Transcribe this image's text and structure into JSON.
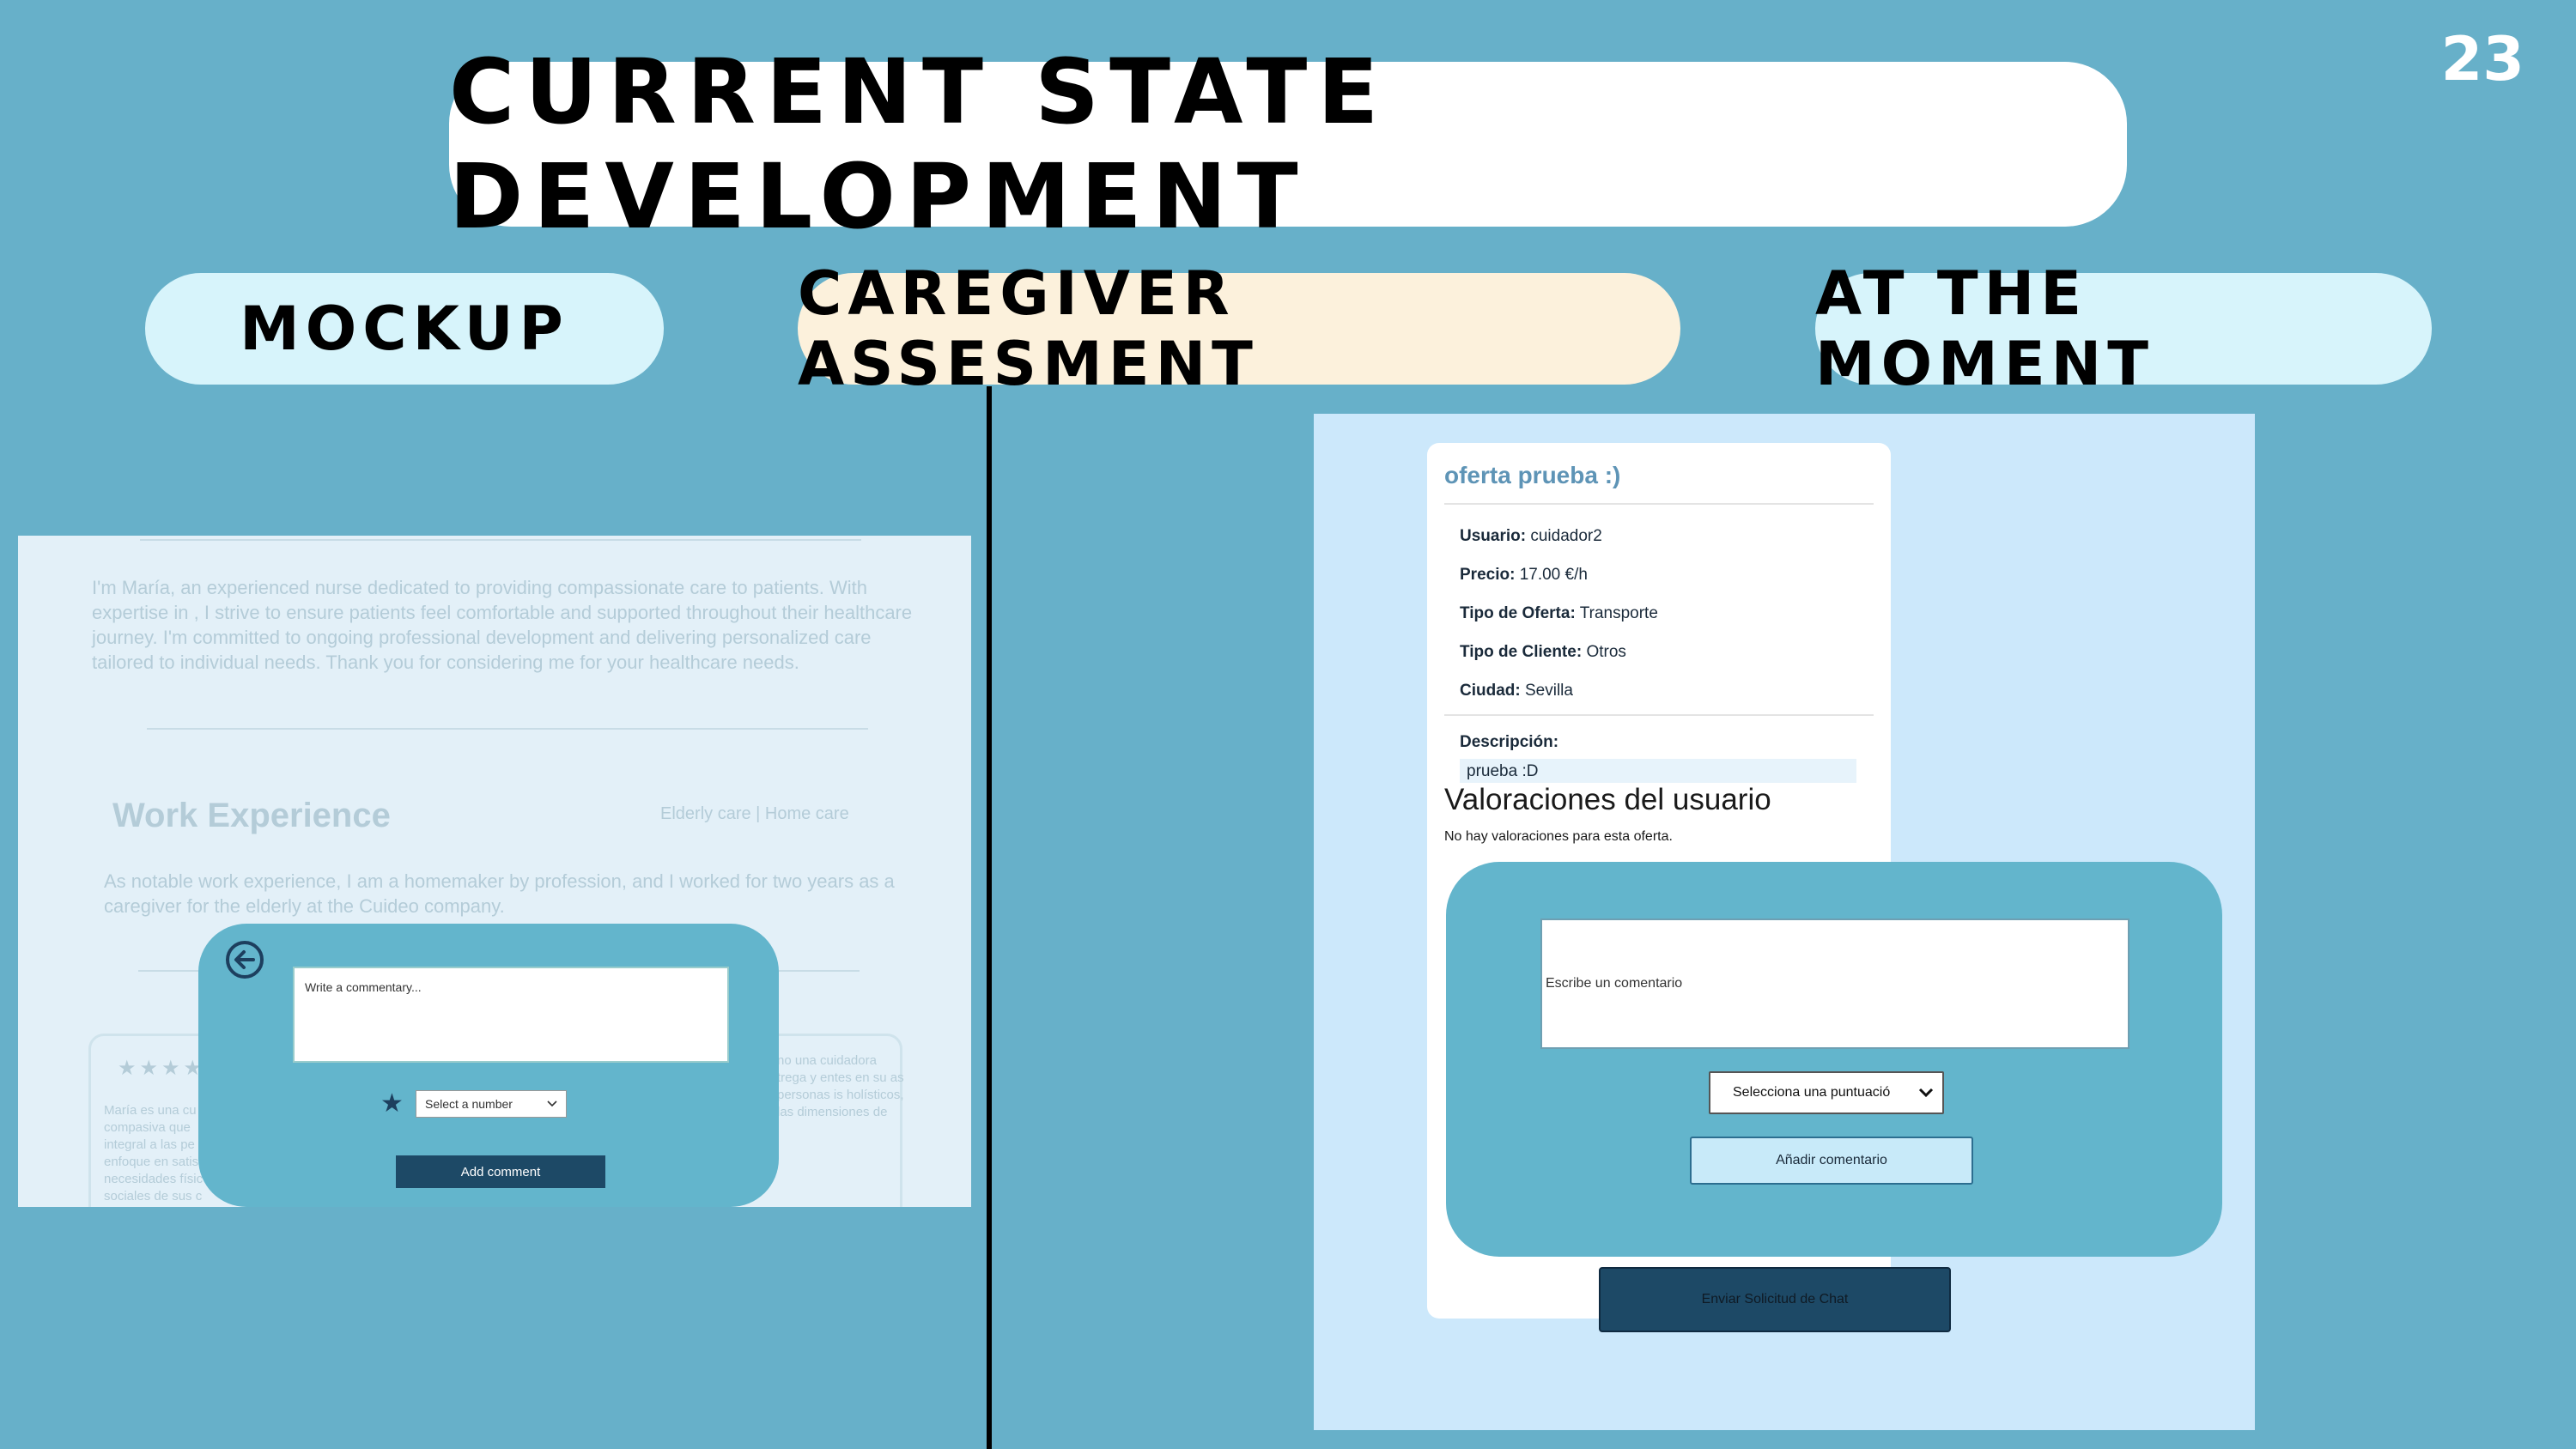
{
  "slide": {
    "title": "CURRENT STATE DEVELOPMENT",
    "page_number": "23",
    "labels": {
      "mockup": "MOCKUP",
      "center": "CAREGIVER ASSESMENT",
      "now": "AT THE MOMENT"
    }
  },
  "mockup": {
    "intro": "I'm María, an experienced nurse dedicated to providing compassionate care to patients. With expertise in , I strive to ensure patients feel comfortable and supported throughout their healthcare journey. I'm committed to ongoing professional development and delivering personalized care tailored to individual needs. Thank you for considering me for your healthcare needs.",
    "work_title": "Work Experience",
    "work_tags": "Elderly care | Home care",
    "work_body": "As notable work experience, I am a homemaker by profession, and I worked for two years as a caregiver for the elderly at the Cuideo company.",
    "review_stars": "★★★★",
    "review_left": "María es una cu compasiva que integral a las pe enfoque en satis necesidades físic sociales de sus c",
    "review_right": "no una cuidadora trega y entes en su as personas is holísticos, las dimensiones de",
    "comment_placeholder": "Write a commentary...",
    "star_glyph": "★",
    "select_value": "Select a number",
    "add_button": "Add comment"
  },
  "app": {
    "offer_title": "oferta prueba :)",
    "fields": [
      {
        "label": "Usuario:",
        "value": "cuidador2"
      },
      {
        "label": "Precio:",
        "value": "17.00 €/h"
      },
      {
        "label": "Tipo de Oferta:",
        "value": "Transporte"
      },
      {
        "label": "Tipo de Cliente:",
        "value": "Otros"
      },
      {
        "label": "Ciudad:",
        "value": "Sevilla"
      }
    ],
    "description_label": "Descripción:",
    "description_value": "prueba :D",
    "ratings_title": "Valoraciones del usuario",
    "ratings_empty": "No hay valoraciones para esta oferta.",
    "comment_placeholder": "Escribe un comentario",
    "select_value": "Selecciona una puntuació",
    "add_button": "Añadir comentario",
    "chat_button": "Enviar Solicitud de Chat"
  }
}
